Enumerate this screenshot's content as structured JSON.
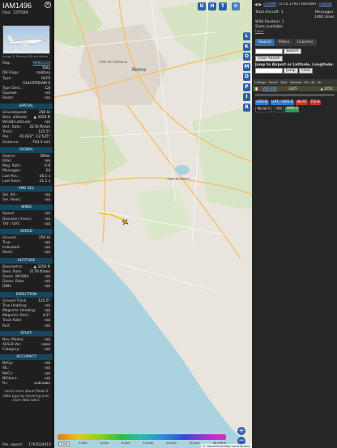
{
  "aircraft": {
    "callsign": "IAM1496",
    "hex_line": "Hex: 33F08A",
    "photo_credit": "Image © Fiorenzo Mirolla Meteo",
    "close_icon": "close-icon"
  },
  "info_rows": [
    {
      "k": "Reg.:",
      "v": "MM62329",
      "link": true
    },
    {
      "k": "",
      "v": "Italy"
    },
    {
      "k": "DB Flags:",
      "v": "military"
    },
    {
      "k": "Type:",
      "v": "GLF5"
    },
    {
      "k": "",
      "v": "GULFSTREAM 5"
    },
    {
      "k": "Type Desc.:",
      "v": "L2J"
    },
    {
      "k": "Squawk:",
      "v": "n/a"
    },
    {
      "k": "Route:",
      "v": "n/a"
    }
  ],
  "sections": [
    {
      "title": "SPATIAL",
      "rows": [
        {
          "k": "Groundspeed:",
          "v": "250 kt"
        },
        {
          "k": "Baro. altitude:",
          "v": "▲ 3250 ft"
        },
        {
          "k": "WGS84 altitude:",
          "v": "n/a"
        },
        {
          "k": "Vert. Rate:",
          "v": "2176 ft/min"
        },
        {
          "k": "Track:",
          "v": "125.5°"
        },
        {
          "k": "Pos.:",
          "v": "41.622°, 12.535°"
        },
        {
          "k": "Distance:",
          "v": "743.3 nmi"
        }
      ]
    },
    {
      "title": "SIGNAL",
      "rows": [
        {
          "k": "Source:",
          "v": "Other"
        },
        {
          "k": "RSSI:",
          "v": "n/a"
        },
        {
          "k": "Msg. Rate:",
          "v": "0.0"
        },
        {
          "k": "Messages:",
          "v": "24"
        },
        {
          "k": "Last Pos.:",
          "v": "16.1 s"
        },
        {
          "k": "Last Seen:",
          "v": "11.1 s"
        }
      ]
    },
    {
      "title": "FMS SEL",
      "rows": [
        {
          "k": "Sel. Alt.:",
          "v": "n/a"
        },
        {
          "k": "Sel. Head.:",
          "v": "n/a"
        }
      ]
    },
    {
      "title": "WIND",
      "rows": [
        {
          "k": "Speed:",
          "v": "n/a"
        },
        {
          "k": "Direction (from):",
          "v": "n/a"
        },
        {
          "k": "TAT / OAT:",
          "v": "n/a"
        }
      ]
    },
    {
      "title": "SPEED",
      "rows": [
        {
          "k": "Ground:",
          "v": "250 kt"
        },
        {
          "k": "True:",
          "v": "n/a"
        },
        {
          "k": "Indicated:",
          "v": "n/a"
        },
        {
          "k": "Mach:",
          "v": "n/a"
        }
      ]
    },
    {
      "title": "ALTITUDE",
      "rows": [
        {
          "k": "Barometric:",
          "v": "▲ 3250 ft"
        },
        {
          "k": "Baro. Rate:",
          "v": "2176 ft/min"
        },
        {
          "k": "Geom. WGS84:",
          "v": "n/a"
        },
        {
          "k": "Geom. Rate:",
          "v": "n/a"
        },
        {
          "k": "QNH:",
          "v": "n/a"
        }
      ]
    },
    {
      "title": "DIRECTION",
      "rows": [
        {
          "k": "Ground Track:",
          "v": "125.5°"
        },
        {
          "k": "True Heading:",
          "v": "n/a"
        },
        {
          "k": "Magnetic Heading:",
          "v": "n/a"
        },
        {
          "k": "Magnetic Decl.:",
          "v": "4.2°"
        },
        {
          "k": "Track Rate:",
          "v": "n/a"
        },
        {
          "k": "Roll:",
          "v": "n/a"
        }
      ]
    },
    {
      "title": "STUFF",
      "rows": [
        {
          "k": "Nav. Modes:",
          "v": "n/a"
        },
        {
          "k": "ADS-B Ver.:",
          "v": "none"
        },
        {
          "k": "Category:",
          "v": "n/a"
        }
      ]
    },
    {
      "title": "ACCURACY",
      "rows": [
        {
          "k": "NACp:",
          "v": "n/a"
        },
        {
          "k": "SIL:",
          "v": "n/a"
        },
        {
          "k": "NACv:",
          "v": "n/a"
        },
        {
          "k": "NICbaro:",
          "v": "n/a"
        },
        {
          "k": "Rc:",
          "v": "unknown"
        }
      ]
    }
  ],
  "learn_more": "Learn more about Mode S data type by hovering over each data label.",
  "epoch": {
    "k": "Pos. epoch:",
    "v": "1763534415"
  },
  "map": {
    "buttons": [
      "U",
      "H",
      "T"
    ],
    "side_buttons": [
      "L",
      "K",
      "O",
      "M",
      "D",
      "P",
      "I",
      "R"
    ],
    "labels": {
      "vatican": "Città del Vaticano",
      "rome": "Roma",
      "lake": "Lago di Albano"
    },
    "legend": [
      "2,000",
      "4,000",
      "6,000",
      "8,000",
      "10,000",
      "20,000",
      "30,000",
      "40,000 ft"
    ],
    "unit_btn": "1 mi",
    "attribution": "© OpenStreetMap contributors",
    "zoom_in": "+",
    "zoom_out": "−"
  },
  "right": {
    "nav": "◀ ▶",
    "site": "sr1090",
    "version": "(3.14.1791) decoder:",
    "decoder": "readsb",
    "total_label": "Total Aircraft: 1",
    "messages_label": "Messages:",
    "messages_value": "1460.3/sec",
    "with_pos": "With Position: 1",
    "stats": "Stats available",
    "stats_link": "here",
    "tabs": [
      "Search",
      "Filters",
      "Columns"
    ],
    "clear_search": "Clear Search",
    "search_btn": "Search",
    "jump_label": "Jump to Airport or Latitude, Longitude:",
    "jump_btn": "Jump",
    "clear_btn": "Clear",
    "table_head": [
      "Callsign",
      "Route",
      "Type",
      "Squawk",
      "Alt. (ft)",
      "Sp"
    ],
    "table_row": {
      "hex": "IAM1496",
      "type": "GLF5",
      "alt": "▲ 3250"
    },
    "badges": [
      {
        "t": "ADS-B",
        "c": "b-blue"
      },
      {
        "t": "UAT / ADS-R",
        "c": "b-blue"
      },
      {
        "t": "MLAT",
        "c": "b-red"
      },
      {
        "t": "TIS-B",
        "c": "b-red"
      },
      {
        "t": "Mode-S",
        "c": "b-plain"
      },
      {
        "t": "AIS",
        "c": "b-plain"
      },
      {
        "t": "ADS-C",
        "c": "b-grn"
      }
    ]
  },
  "colors": {
    "accent": "#2f5eaa",
    "section_bg": "#16465f",
    "link": "#6fa8ff",
    "track": "#e8c51c"
  }
}
